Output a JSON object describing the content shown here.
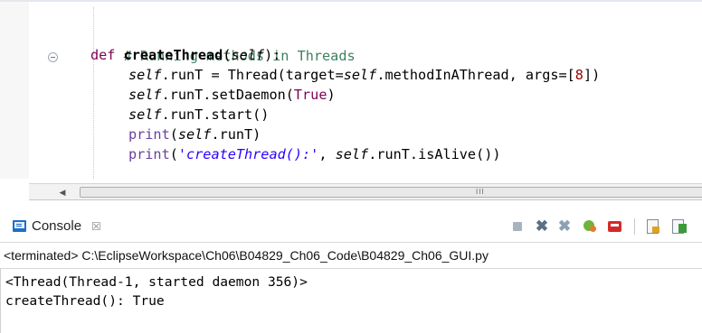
{
  "editor": {
    "lines": [
      {
        "id": "comment",
        "text": "# Running methods in Threads"
      },
      {
        "id": "def",
        "keyword": "def",
        "name": "createThread",
        "open": "(",
        "param": "self",
        "close": "):"
      },
      {
        "id": "assign",
        "self": "self",
        "p1": ".runT = Thread(target=",
        "self2": "self",
        "p2": ".methodInAThread, args=[",
        "num": "8",
        "p3": "])"
      },
      {
        "id": "daemon",
        "self": "self",
        "p1": ".runT.setDaemon(",
        "kw": "True",
        "p2": ")"
      },
      {
        "id": "start",
        "self": "self",
        "p1": ".runT.start()"
      },
      {
        "id": "print1",
        "builtin": "print",
        "p1": "(",
        "self": "self",
        "p2": ".runT)"
      },
      {
        "id": "print2",
        "builtin": "print",
        "p1": "(",
        "str": "'createThread():'",
        "p2": ", ",
        "self": "self",
        "p3": ".runT.isAlive())"
      }
    ],
    "scrollbar": {
      "left_arrow": "◀",
      "grip": "III"
    }
  },
  "console": {
    "tab_label": "Console",
    "close_glyph": "☒",
    "toolbar": {
      "terminate": "terminate-icon",
      "remove_launch": "✖",
      "remove_all": "✖",
      "run": "run-icon",
      "pin": "pin-icon",
      "scroll_lock": "scroll-lock-icon",
      "word_wrap": "word-wrap-icon"
    },
    "status": "<terminated> C:\\EclipseWorkspace\\Ch06\\B04829_Ch06_Code\\B04829_Ch06_GUI.py",
    "output": [
      "<Thread(Thread-1, started daemon 356)>",
      "createThread(): True"
    ]
  }
}
